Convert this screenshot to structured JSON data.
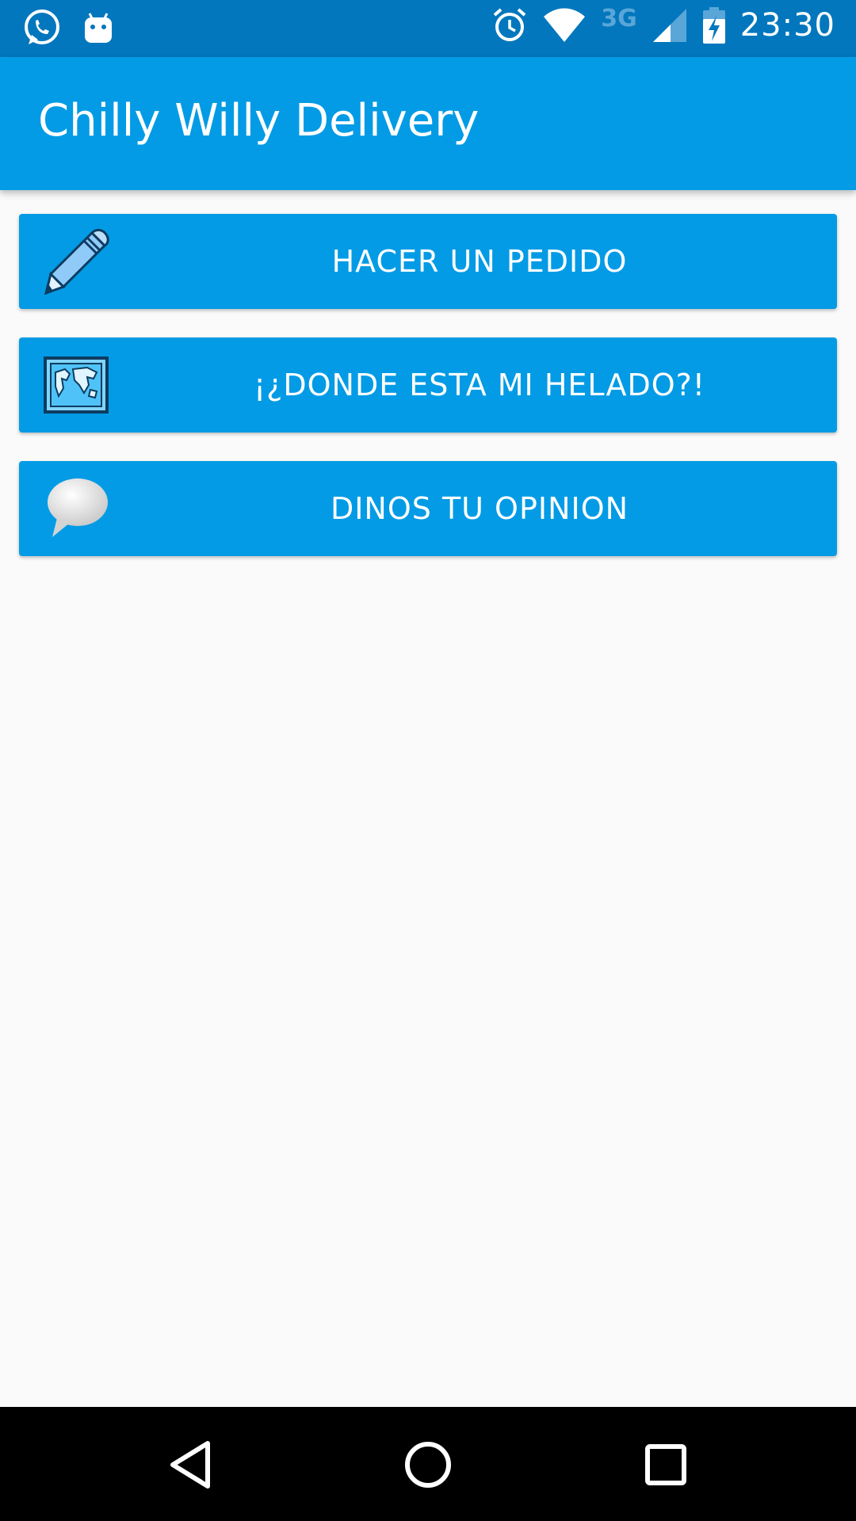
{
  "status_bar": {
    "time": "23:30",
    "network": "3G",
    "left_icons": [
      "whatsapp-icon",
      "android-icon"
    ],
    "right_icons": [
      "alarm-icon",
      "wifi-icon",
      "signal-icon",
      "battery-charging-icon"
    ]
  },
  "app_bar": {
    "title": "Chilly Willy Delivery",
    "color": "#039be5"
  },
  "menu": {
    "items": [
      {
        "label": "HACER UN PEDIDO",
        "icon": "pencil-icon"
      },
      {
        "label": "¡¿DONDE ESTA MI HELADO?!",
        "icon": "world-map-icon"
      },
      {
        "label": "DINOS TU OPINION",
        "icon": "speech-bubble-icon"
      }
    ]
  },
  "nav_bar": {
    "buttons": [
      "back-icon",
      "home-icon",
      "recents-icon"
    ]
  },
  "colors": {
    "status_bar": "#0277bd",
    "primary": "#039be5",
    "background": "#fafafa"
  }
}
